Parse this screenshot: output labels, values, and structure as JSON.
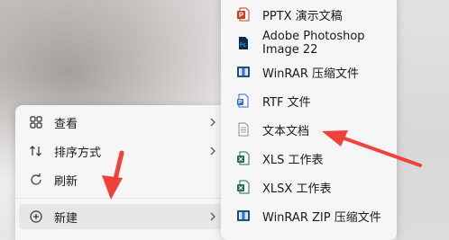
{
  "main_menu": {
    "items": [
      {
        "label": "查看",
        "icon": "grid-view-icon",
        "has_submenu": true
      },
      {
        "label": "排序方式",
        "icon": "sort-icon",
        "has_submenu": true
      },
      {
        "label": "刷新",
        "icon": "refresh-icon",
        "has_submenu": false
      },
      {
        "label": "新建",
        "icon": "plus-circle-icon",
        "has_submenu": true
      }
    ]
  },
  "new_submenu": {
    "items": [
      {
        "label": "PPTX 演示文稿",
        "icon": "pptx-file-icon"
      },
      {
        "label": "Adobe Photoshop Image 22",
        "icon": "photoshop-file-icon"
      },
      {
        "label": "WinRAR 压缩文件",
        "icon": "winrar-archive-icon"
      },
      {
        "label": "RTF 文件",
        "icon": "rtf-file-icon"
      },
      {
        "label": "文本文档",
        "icon": "text-document-icon"
      },
      {
        "label": "XLS 工作表",
        "icon": "xls-file-icon"
      },
      {
        "label": "XLSX 工作表",
        "icon": "xlsx-file-icon"
      },
      {
        "label": "WinRAR ZIP 压缩文件",
        "icon": "winrar-zip-icon"
      }
    ]
  },
  "colors": {
    "annotation_arrow": "#f0413a",
    "menu_background": "#f6f6f6",
    "hover_background": "#e7e7e7"
  }
}
